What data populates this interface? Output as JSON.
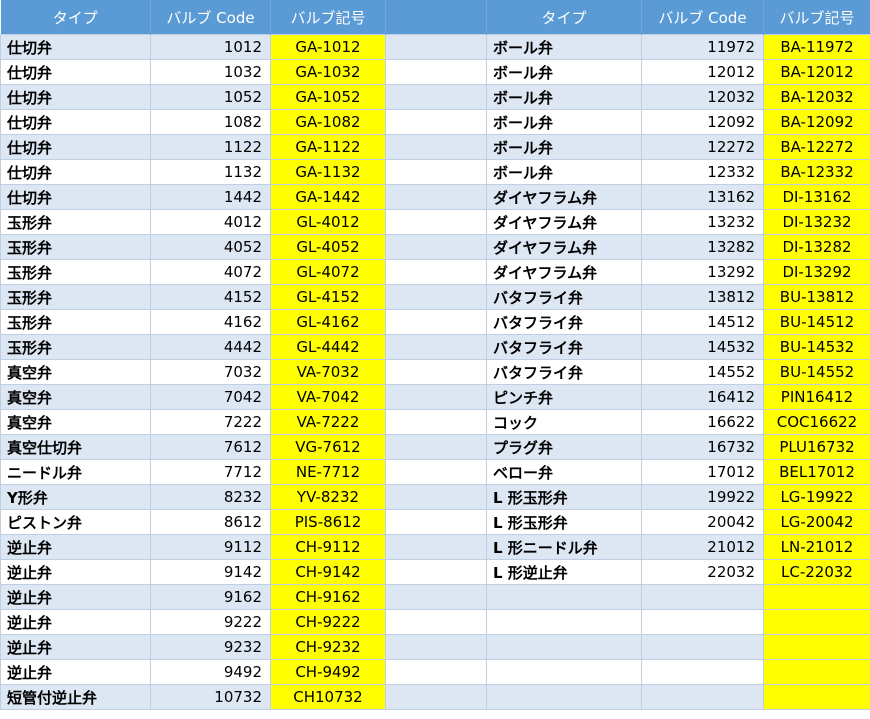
{
  "header": {
    "type": "タイプ",
    "code": "バルブ Code",
    "symbol": "バルブ記号"
  },
  "left_rows": [
    {
      "type": "仕切弁",
      "code": "1012",
      "symbol": "GA-1012"
    },
    {
      "type": "仕切弁",
      "code": "1032",
      "symbol": "GA-1032"
    },
    {
      "type": "仕切弁",
      "code": "1052",
      "symbol": "GA-1052"
    },
    {
      "type": "仕切弁",
      "code": "1082",
      "symbol": "GA-1082"
    },
    {
      "type": "仕切弁",
      "code": "1122",
      "symbol": "GA-1122"
    },
    {
      "type": "仕切弁",
      "code": "1132",
      "symbol": "GA-1132"
    },
    {
      "type": "仕切弁",
      "code": "1442",
      "symbol": "GA-1442"
    },
    {
      "type": "玉形弁",
      "code": "4012",
      "symbol": "GL-4012"
    },
    {
      "type": "玉形弁",
      "code": "4052",
      "symbol": "GL-4052"
    },
    {
      "type": "玉形弁",
      "code": "4072",
      "symbol": "GL-4072"
    },
    {
      "type": "玉形弁",
      "code": "4152",
      "symbol": "GL-4152"
    },
    {
      "type": "玉形弁",
      "code": "4162",
      "symbol": "GL-4162"
    },
    {
      "type": "玉形弁",
      "code": "4442",
      "symbol": "GL-4442"
    },
    {
      "type": "真空弁",
      "code": "7032",
      "symbol": "VA-7032"
    },
    {
      "type": "真空弁",
      "code": "7042",
      "symbol": "VA-7042"
    },
    {
      "type": "真空弁",
      "code": "7222",
      "symbol": "VA-7222"
    },
    {
      "type": "真空仕切弁",
      "code": "7612",
      "symbol": "VG-7612"
    },
    {
      "type": "ニードル弁",
      "code": "7712",
      "symbol": "NE-7712"
    },
    {
      "type": "Y形弁",
      "code": "8232",
      "symbol": "YV-8232"
    },
    {
      "type": "ピストン弁",
      "code": "8612",
      "symbol": "PIS-8612"
    },
    {
      "type": "逆止弁",
      "code": "9112",
      "symbol": "CH-9112"
    },
    {
      "type": "逆止弁",
      "code": "9142",
      "symbol": "CH-9142"
    },
    {
      "type": "逆止弁",
      "code": "9162",
      "symbol": "CH-9162"
    },
    {
      "type": "逆止弁",
      "code": "9222",
      "symbol": "CH-9222"
    },
    {
      "type": "逆止弁",
      "code": "9232",
      "symbol": "CH-9232"
    },
    {
      "type": "逆止弁",
      "code": "9492",
      "symbol": "CH-9492"
    },
    {
      "type": "短管付逆止弁",
      "code": "10732",
      "symbol": "CH10732"
    }
  ],
  "right_rows": [
    {
      "type": "ボール弁",
      "code": "11972",
      "symbol": "BA-11972"
    },
    {
      "type": "ボール弁",
      "code": "12012",
      "symbol": "BA-12012"
    },
    {
      "type": "ボール弁",
      "code": "12032",
      "symbol": "BA-12032"
    },
    {
      "type": "ボール弁",
      "code": "12092",
      "symbol": "BA-12092"
    },
    {
      "type": "ボール弁",
      "code": "12272",
      "symbol": "BA-12272"
    },
    {
      "type": "ボール弁",
      "code": "12332",
      "symbol": "BA-12332"
    },
    {
      "type": "ダイヤフラム弁",
      "code": "13162",
      "symbol": "DI-13162"
    },
    {
      "type": "ダイヤフラム弁",
      "code": "13232",
      "symbol": "DI-13232"
    },
    {
      "type": "ダイヤフラム弁",
      "code": "13282",
      "symbol": "DI-13282"
    },
    {
      "type": "ダイヤフラム弁",
      "code": "13292",
      "symbol": "DI-13292"
    },
    {
      "type": "バタフライ弁",
      "code": "13812",
      "symbol": "BU-13812"
    },
    {
      "type": "バタフライ弁",
      "code": "14512",
      "symbol": "BU-14512"
    },
    {
      "type": "バタフライ弁",
      "code": "14532",
      "symbol": "BU-14532"
    },
    {
      "type": "バタフライ弁",
      "code": "14552",
      "symbol": "BU-14552"
    },
    {
      "type": "ピンチ弁",
      "code": "16412",
      "symbol": "PIN16412"
    },
    {
      "type": "コック",
      "code": "16622",
      "symbol": "COC16622"
    },
    {
      "type": "プラグ弁",
      "code": "16732",
      "symbol": "PLU16732"
    },
    {
      "type": "ベロー弁",
      "code": "17012",
      "symbol": "BEL17012"
    },
    {
      "type": "L 形玉形弁",
      "code": "19922",
      "symbol": "LG-19922"
    },
    {
      "type": "L 形玉形弁",
      "code": "20042",
      "symbol": "LG-20042"
    },
    {
      "type": "L 形ニードル弁",
      "code": "21012",
      "symbol": "LN-21012"
    },
    {
      "type": "L 形逆止弁",
      "code": "22032",
      "symbol": "LC-22032"
    },
    {
      "type": "",
      "code": "",
      "symbol": ""
    },
    {
      "type": "",
      "code": "",
      "symbol": ""
    },
    {
      "type": "",
      "code": "",
      "symbol": ""
    },
    {
      "type": "",
      "code": "",
      "symbol": ""
    },
    {
      "type": "",
      "code": "",
      "symbol": ""
    }
  ]
}
